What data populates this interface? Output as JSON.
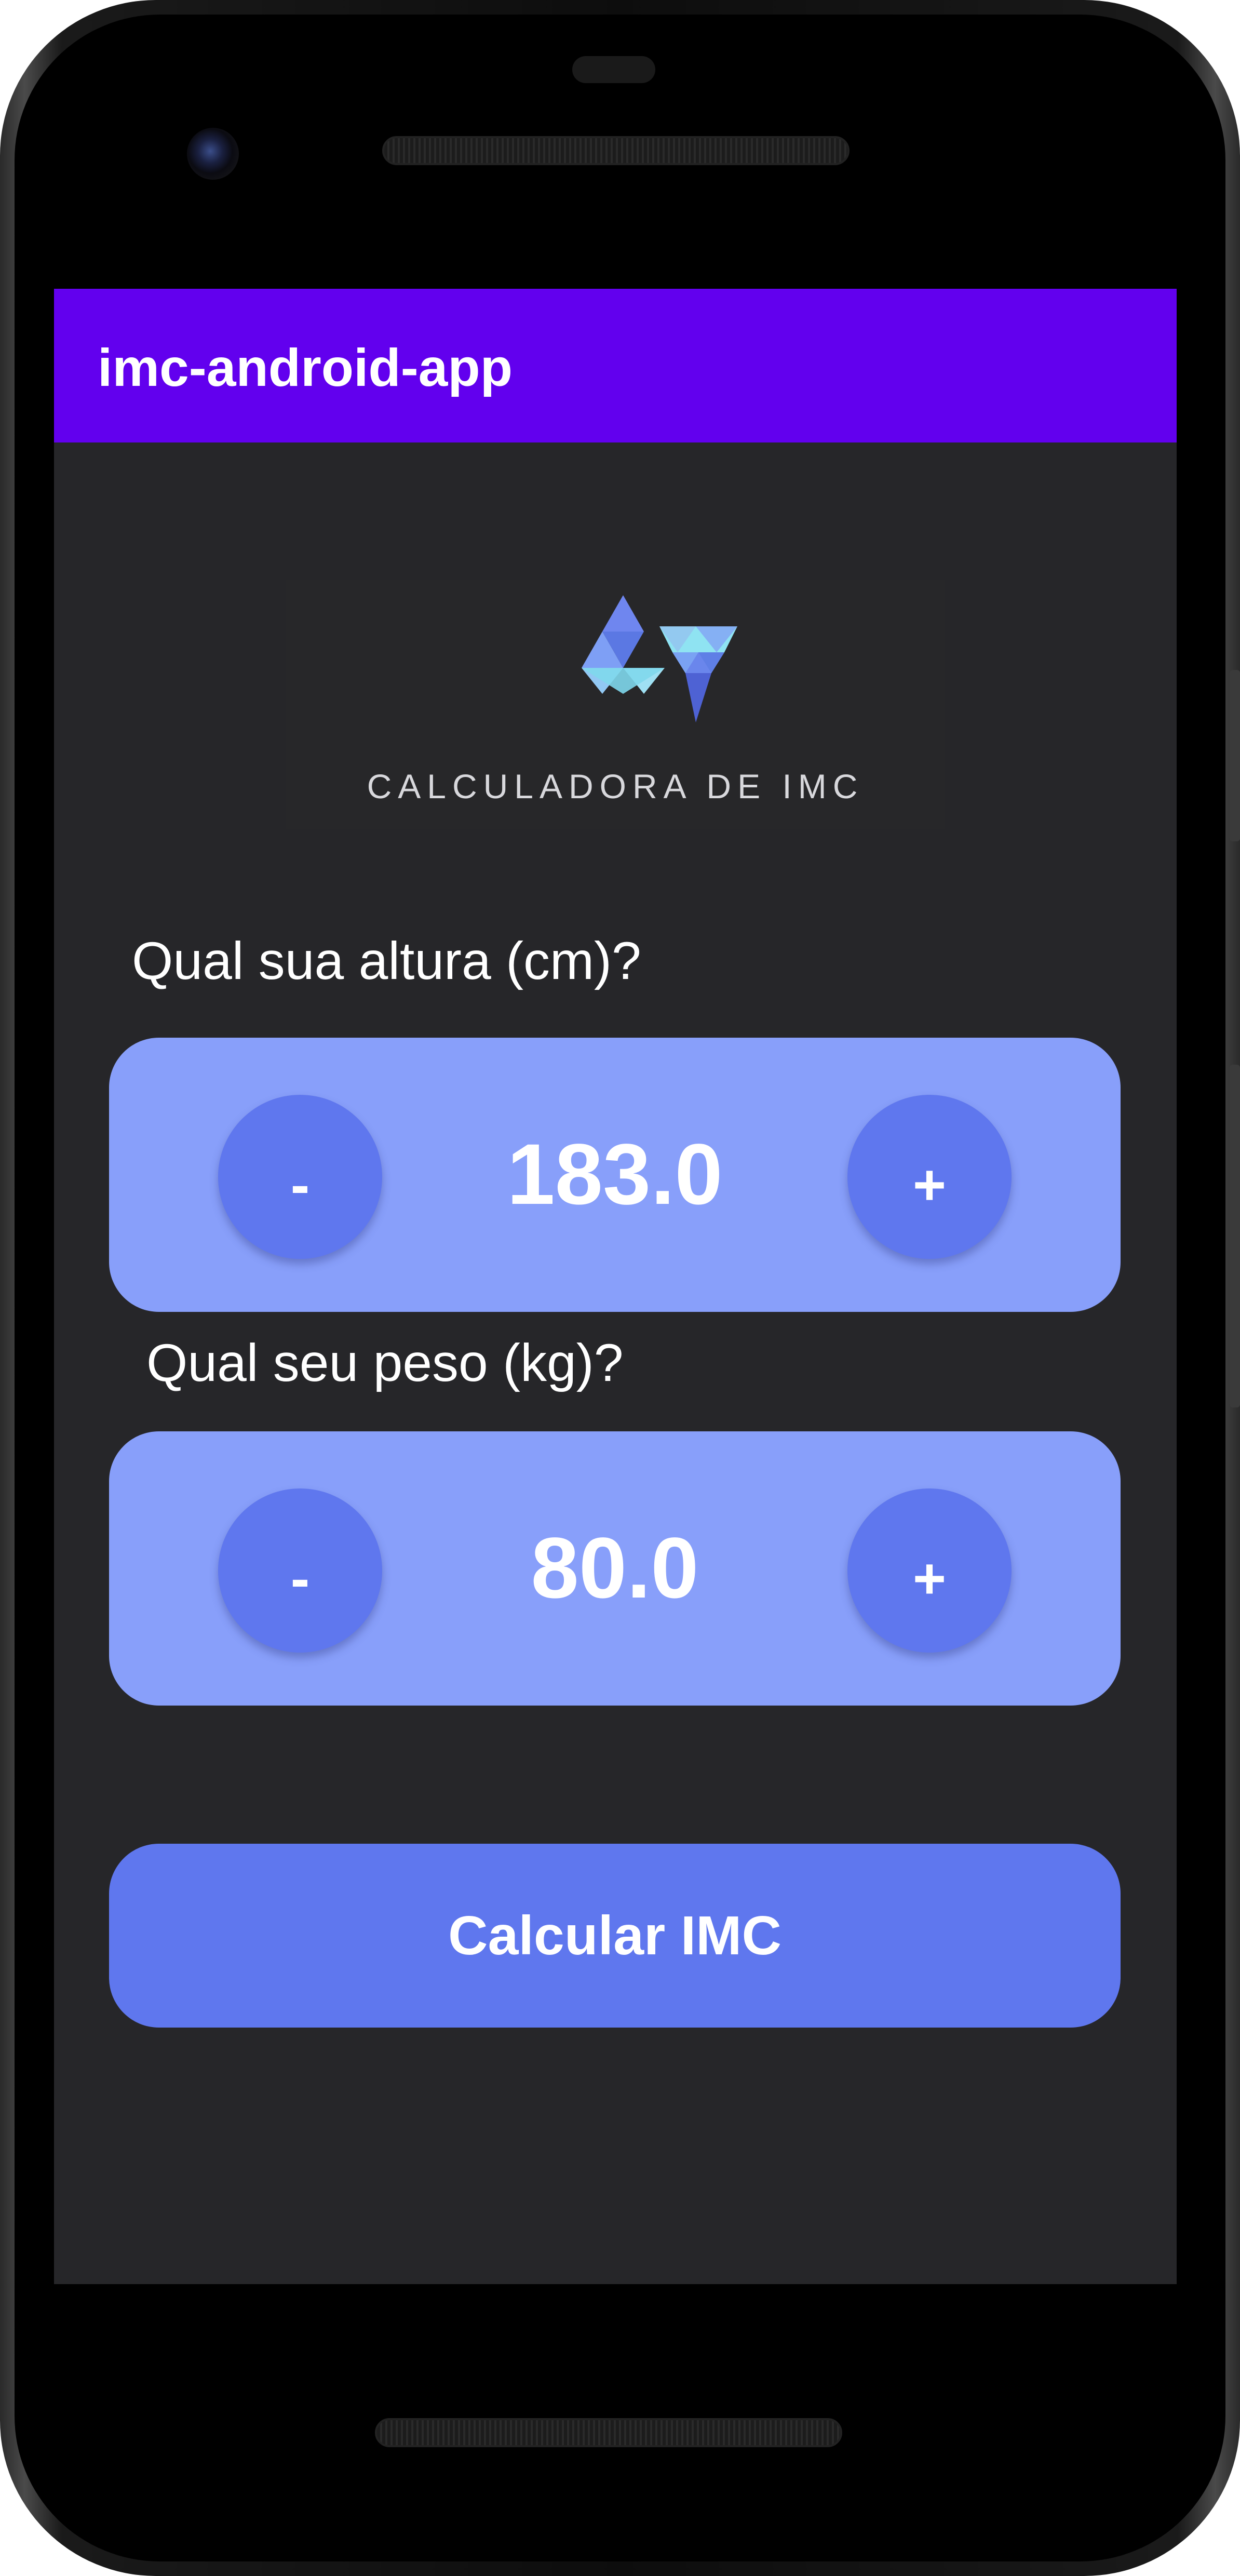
{
  "app_bar": {
    "title": "imc-android-app",
    "color": "#6200ee"
  },
  "logo": {
    "icon": "triangles-logo-icon",
    "text": "CALCULADORA DE IMC"
  },
  "height_section": {
    "question": "Qual sua altura (cm)?",
    "value": "183.0",
    "minus_label": "-",
    "plus_label": "+"
  },
  "weight_section": {
    "question": "Qual seu peso (kg)?",
    "value": "80.0",
    "minus_label": "-",
    "plus_label": "+"
  },
  "calculate_button": {
    "label": "Calcular IMC"
  },
  "colors": {
    "background": "#262629",
    "stepper_bg": "#889ffa",
    "accent": "#5f77ee"
  }
}
